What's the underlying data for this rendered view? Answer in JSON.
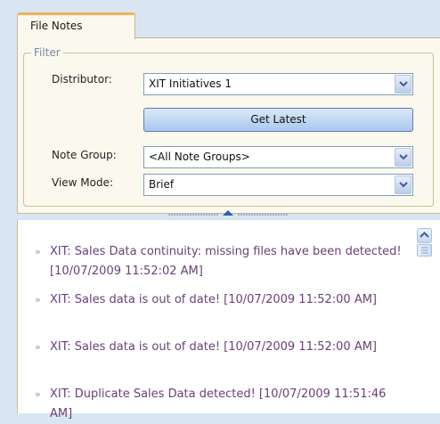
{
  "tab": {
    "label": "File Notes"
  },
  "filter": {
    "legend": "Filter",
    "distributor": {
      "label": "Distributor:",
      "value": "XIT Initiatives 1"
    },
    "get_latest_label": "Get Latest",
    "note_group": {
      "label": "Note Group:",
      "value": "<All Note Groups>"
    },
    "view_mode": {
      "label": "View Mode:",
      "value": "Brief"
    }
  },
  "notes": [
    {
      "text": "XIT: Sales Data continuity: missing files have been detected! [10/07/2009 11:52:02 AM]"
    },
    {
      "text": "XIT: Sales data is out of date! [10/07/2009 11:52:00 AM]"
    },
    {
      "text": "XIT: Sales data is out of date! [10/07/2009 11:52:00 AM]"
    },
    {
      "text": "XIT: Duplicate Sales Data detected! [10/07/2009 11:51:46 AM]"
    }
  ],
  "bullet_glyph": "»",
  "colors": {
    "note_text": "#6a3f78",
    "tab_accent": "#f1b25a",
    "panel_bg": "#fbf8ee"
  }
}
